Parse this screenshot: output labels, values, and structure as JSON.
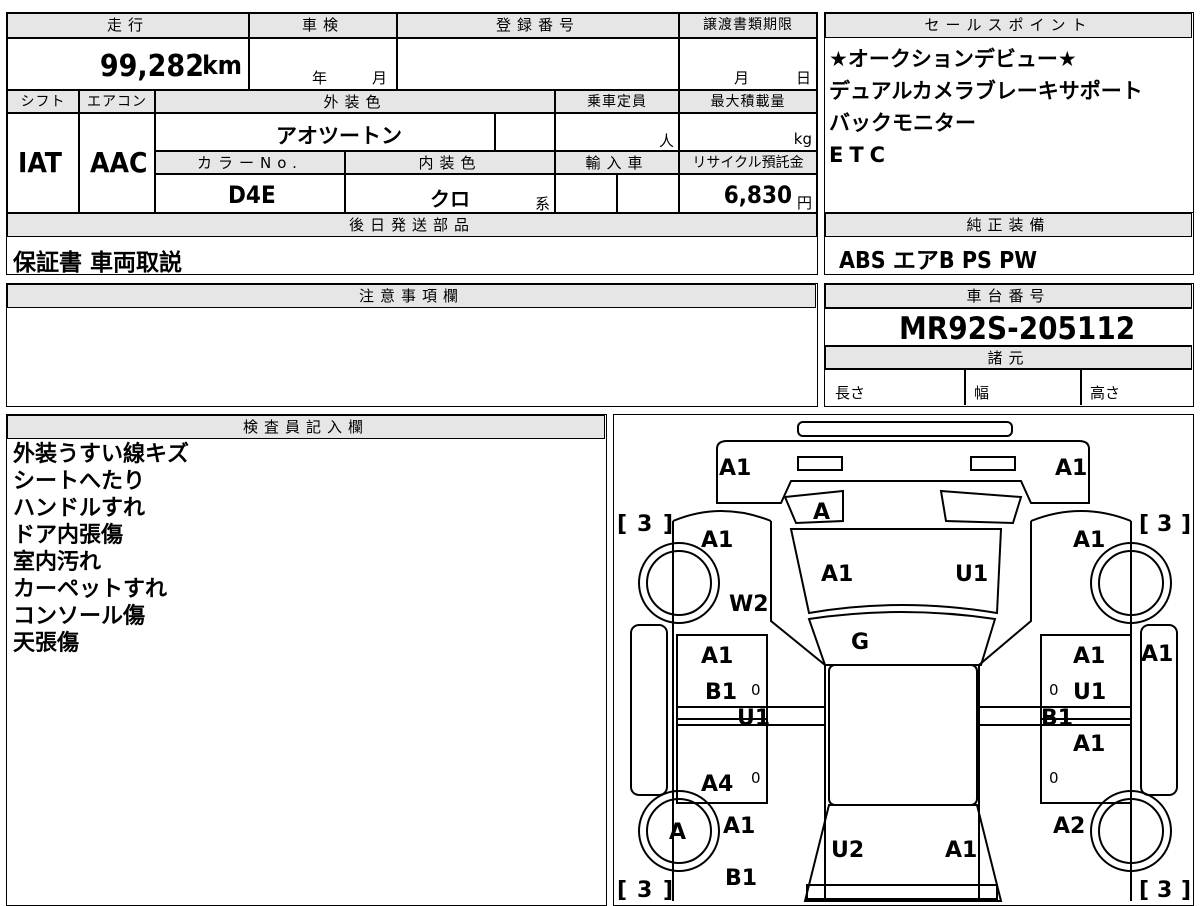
{
  "top_row": {
    "mileage_label": "走行",
    "mileage_value": "99,282",
    "mileage_unit": "km",
    "shaken_label": "車検",
    "year_label": "年",
    "month_label": "月",
    "reg_label": "登録番号",
    "transfer_label": "譲渡書類期限",
    "transfer_month": "月",
    "transfer_day": "日"
  },
  "spec_row": {
    "shift_label": "シフト",
    "shift_value": "IAT",
    "ac_label": "エアコン",
    "ac_value": "AAC",
    "exterior_label": "外装色",
    "exterior_value": "アオツートン",
    "capacity_label": "乗車定員",
    "capacity_unit": "人",
    "maxload_label": "最大積載量",
    "maxload_unit": "kg",
    "color_no_label": "カラーNo.",
    "color_no_value": "D4E",
    "interior_label": "内装色",
    "interior_value": "クロ",
    "interior_suffix": "系",
    "import_label": "輸入車",
    "recycle_label": "リサイクル預託金",
    "recycle_value": "6,830",
    "recycle_unit": "円"
  },
  "deferred": {
    "header": "後日発送部品",
    "value": "保証書 車両取説"
  },
  "sales_points": {
    "header": "セールスポイント",
    "lines": [
      "★オークションデビュー★",
      "デュアルカメラブレーキサポート",
      "バックモニター",
      "ETC"
    ]
  },
  "standard_equipment": {
    "header": "純正装備",
    "value": "ABS エアB PS PW"
  },
  "notes": {
    "header": "注意事項欄"
  },
  "chassis": {
    "header": "車台番号",
    "value": "MR92S-205112"
  },
  "specs": {
    "header": "諸元",
    "length_label": "長さ",
    "width_label": "幅",
    "height_label": "高さ"
  },
  "inspector": {
    "header": "検査員記入欄",
    "lines": [
      "外装うすい線キズ",
      "シートへたり",
      "ハンドルすれ",
      "ドア内張傷",
      "室内汚れ",
      "カーペットすれ",
      "コンソール傷",
      "天張傷"
    ]
  },
  "diagram": {
    "marks": {
      "front_left": "A1",
      "front_right": "A1",
      "grille": "A",
      "tire_fl": "3",
      "tire_fr": "3",
      "tire_rl": "3",
      "tire_rr": "3",
      "fender_fl": "A1",
      "fender_fr": "A1",
      "hood_left": "A1",
      "hood_right": "U1",
      "pillar_left": "W2",
      "windshield": "G",
      "door_fl_1": "A1",
      "door_fl_2": "B1",
      "door_fl_3": "U1",
      "door_rl": "A4",
      "door_fr_1": "A1",
      "door_fr_2": "U1",
      "door_fr_3": "B1",
      "door_rr": "A1",
      "side_right": "A1",
      "wheel_rl": "A",
      "fender_rl_1": "A1",
      "fender_rl_2": "B1",
      "fender_rr": "A2",
      "roof_rear_left": "U2",
      "roof_rear_right": "A1",
      "zero": "0"
    }
  }
}
